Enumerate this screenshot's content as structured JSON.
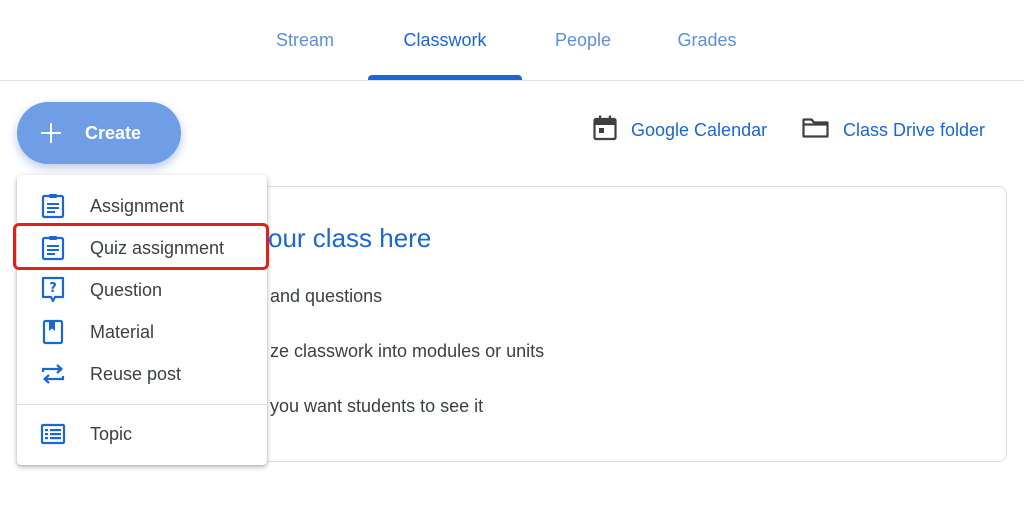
{
  "tabs": [
    {
      "label": "Stream"
    },
    {
      "label": "Classwork"
    },
    {
      "label": "People"
    },
    {
      "label": "Grades"
    }
  ],
  "active_tab": "Classwork",
  "create_button": {
    "label": "Create",
    "icon": "plus-icon"
  },
  "links": {
    "calendar": {
      "label": "Google Calendar",
      "icon": "calendar-icon"
    },
    "drive": {
      "label": "Class Drive folder",
      "icon": "folder-icon"
    }
  },
  "card": {
    "title": "our class here",
    "lines": [
      "and questions",
      "ze classwork into modules or units",
      "you want students to see it"
    ]
  },
  "menu": {
    "items": [
      {
        "label": "Assignment",
        "icon": "assignment-icon"
      },
      {
        "label": "Quiz assignment",
        "icon": "quiz-assignment-icon"
      },
      {
        "label": "Question",
        "icon": "question-icon"
      },
      {
        "label": "Material",
        "icon": "material-icon"
      },
      {
        "label": "Reuse post",
        "icon": "reuse-post-icon"
      }
    ],
    "topic": {
      "label": "Topic",
      "icon": "topic-icon"
    }
  },
  "colors": {
    "accent": "#1967d2",
    "create_button": "#6f9de6",
    "highlight": "#e0201a"
  }
}
